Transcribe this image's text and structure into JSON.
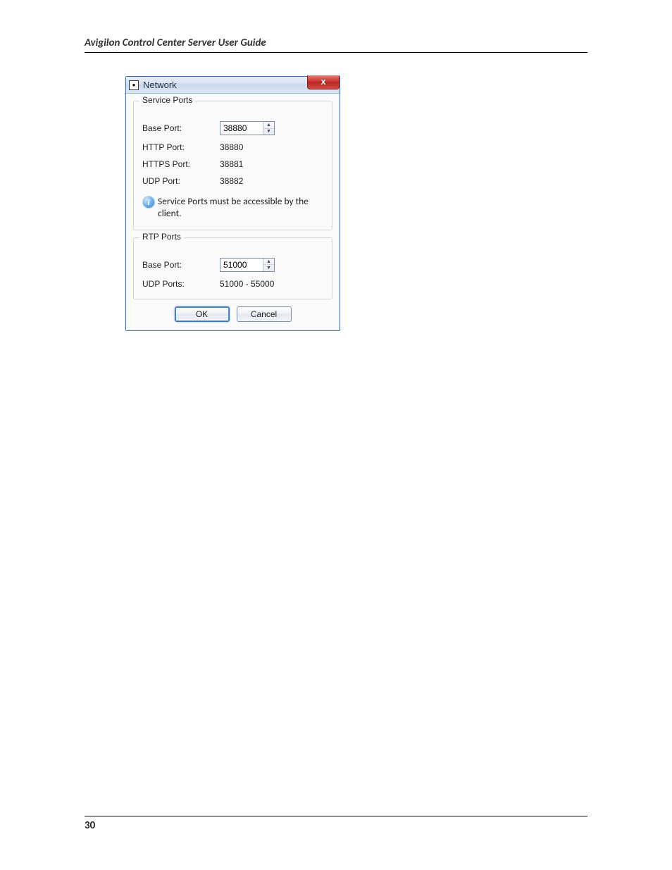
{
  "page": {
    "header_title": "Avigilon Control Center Server User Guide",
    "page_number": "30"
  },
  "dialog": {
    "title": "Network",
    "close_label": "x",
    "service_ports": {
      "legend": "Service Ports",
      "base_port_label": "Base Port:",
      "base_port_value": "38880",
      "http_port_label": "HTTP Port:",
      "http_port_value": "38880",
      "https_port_label": "HTTPS Port:",
      "https_port_value": "38881",
      "udp_port_label": "UDP Port:",
      "udp_port_value": "38882",
      "info_text": "Service Ports must be accessible by the client."
    },
    "rtp_ports": {
      "legend": "RTP Ports",
      "base_port_label": "Base Port:",
      "base_port_value": "51000",
      "udp_ports_label": "UDP Ports:",
      "udp_ports_value": "51000 - 55000"
    },
    "buttons": {
      "ok": "OK",
      "cancel": "Cancel"
    }
  }
}
